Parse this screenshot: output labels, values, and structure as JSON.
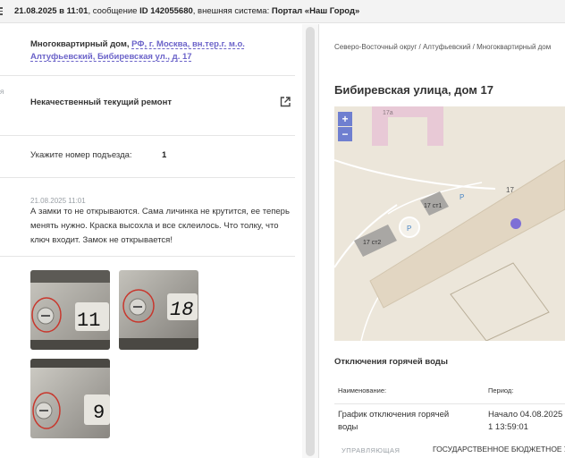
{
  "header": {
    "date": "21.08.2025 в 11:01",
    "message_prefix": ", сообщение ",
    "message_id": "ID 142055680",
    "system_prefix": ", внешняя система: ",
    "system_name": "Портал «Наш Город»"
  },
  "address": {
    "prefix": "Многоквартирный дом, ",
    "link": "РФ, г. Москва, вн.тер.г. м.о. Алтуфьевский, Бибиревская ул., д. 17"
  },
  "problem": {
    "edge_label": "я",
    "title": "Некачественный текущий ремонт"
  },
  "entrance": {
    "label": "Укажите номер подъезда:",
    "value": "1"
  },
  "comment": {
    "date": "21.08.2025 11:01",
    "text": "А замки то не открываются. Сама личинка не крутится, ее теперь менять нужно. Краска высохла и все склеилось. Что толку, что ключ входит. Замок не открывается!"
  },
  "photos": [
    {
      "number": "11"
    },
    {
      "number": "18"
    },
    {
      "number": "9"
    }
  ],
  "right": {
    "breadcrumb": "Северо-Восточный округ / Алтуфьевский / Многоквартирный дом",
    "title": "Бибиревская улица, дом 17",
    "map": {
      "zoom_in": "+",
      "zoom_out": "−",
      "labels": {
        "b17a": "17а",
        "b17": "17",
        "st1": "17 ст1",
        "st2": "17 ст2",
        "parking": "P"
      }
    },
    "section_title": "Отключения горячей воды",
    "table": {
      "col_name": "Наименование:",
      "col_period": "Период:",
      "row_name": "График отключения горячей воды",
      "row_period": "Начало 04.08.2025 1 13:59:01"
    },
    "bottom": {
      "label": "УПРАВЛЯЮЩАЯ",
      "value": "ГОСУДАРСТВЕННОЕ БЮДЖЕТНОЕ У"
    }
  }
}
